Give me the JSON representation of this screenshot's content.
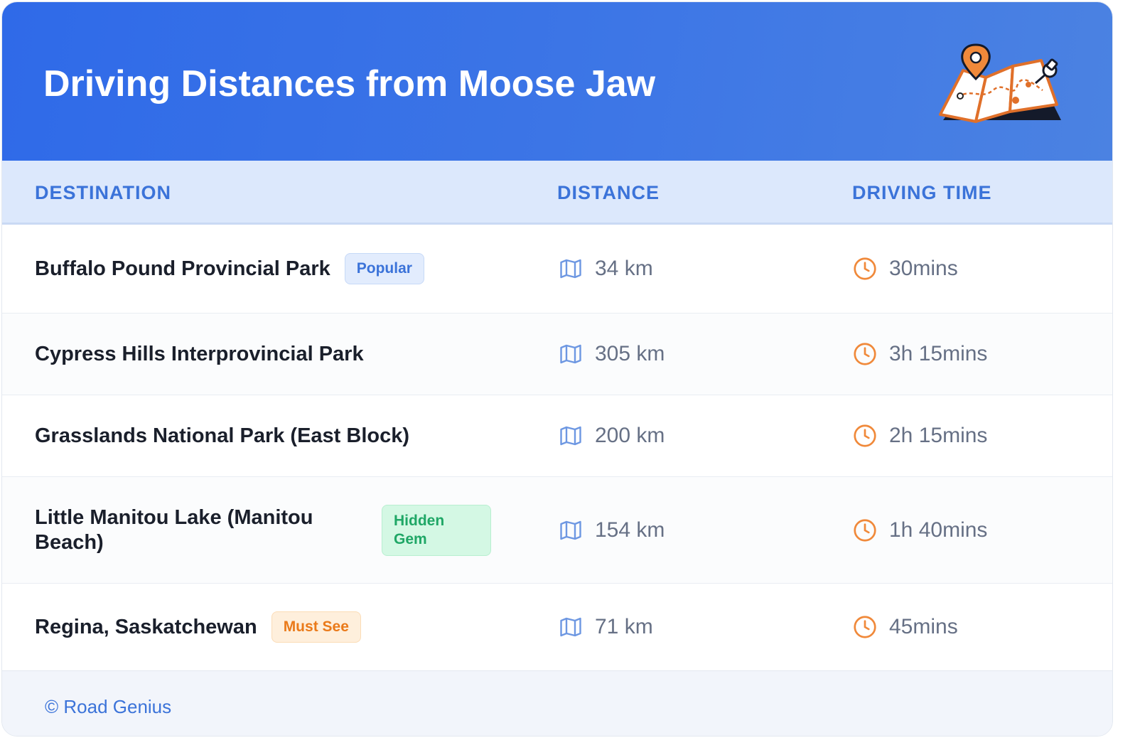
{
  "header": {
    "title": "Driving Distances from Moose Jaw"
  },
  "table": {
    "columns": [
      "DESTINATION",
      "DISTANCE",
      "DRIVING TIME"
    ],
    "rows": [
      {
        "destination": "Buffalo Pound Provincial Park",
        "badge": "Popular",
        "distance": "34 km",
        "time": "30mins"
      },
      {
        "destination": "Cypress Hills Interprovincial Park",
        "badge": "",
        "distance": "305 km",
        "time": "3h 15mins"
      },
      {
        "destination": "Grasslands National Park (East Block)",
        "badge": "",
        "distance": "200 km",
        "time": "2h 15mins"
      },
      {
        "destination": "Little Manitou Lake (Manitou Beach)",
        "badge": "Hidden Gem",
        "distance": "154 km",
        "time": "1h 40mins"
      },
      {
        "destination": "Regina, Saskatchewan",
        "badge": "Must See",
        "distance": "71 km",
        "time": "45mins"
      }
    ]
  },
  "footer": {
    "credit": "© Road Genius"
  },
  "icons": {
    "distance": "map-icon",
    "time": "clock-icon",
    "header_illustration": "folded-map-with-pins-icon"
  },
  "colors": {
    "header_blue": "#2f6ae8",
    "accent_blue": "#3b73d9",
    "icon_orange": "#f0893a",
    "popular_badge": "#e2ecfd",
    "hidden_gem_badge": "#d4f8e4",
    "must_see_badge": "#feefdc"
  }
}
